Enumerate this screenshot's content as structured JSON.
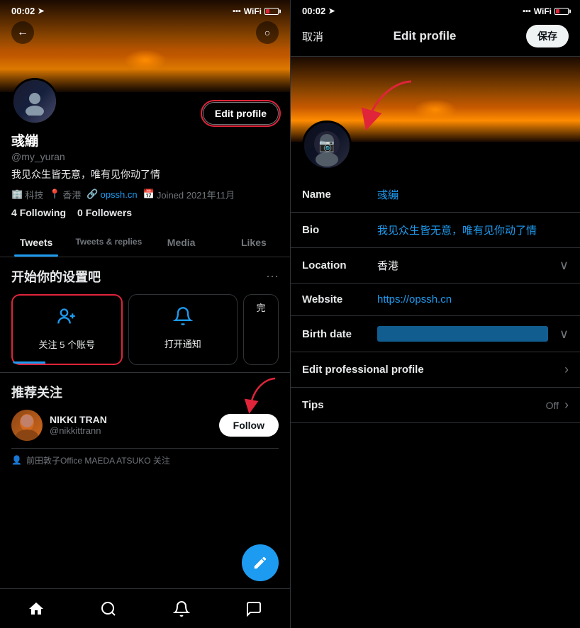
{
  "left": {
    "status_time": "00:02",
    "back_icon": "←",
    "search_icon": "🔍",
    "cover_alt": "sunset mountain cover",
    "avatar_emoji": "👩",
    "edit_profile_label": "Edit profile",
    "profile_name": "彧繃",
    "profile_handle": "@my_yuran",
    "profile_bio": "我见众生皆无意，唯有见你动了情",
    "meta_industry": "科技",
    "meta_location": "香港",
    "meta_website": "opssh.cn",
    "meta_joined": "Joined 2021年11月",
    "following_count": "4",
    "following_label": "Following",
    "followers_count": "0",
    "followers_label": "Followers",
    "tabs": [
      "Tweets",
      "Tweets & replies",
      "Media",
      "Likes"
    ],
    "active_tab": "Tweets",
    "setup_title": "开始你的设置吧",
    "setup_dots": "···",
    "setup_card1_text": "关注 5 个账号",
    "setup_card2_text": "打开通知",
    "setup_card3_text": "完",
    "recommended_title": "推荐关注",
    "rec_user_name": "NIKKI TRAN",
    "rec_user_handle": "@nikkittrann",
    "follow_label": "Follow",
    "mutual_text": "前田敦子Office MAEDA ATSUKO 关注",
    "fab_icon": "✎",
    "nav_home": "⌂",
    "nav_search": "🔍",
    "nav_bell": "🔔",
    "nav_mail": "✉"
  },
  "right": {
    "status_time": "00:02",
    "cancel_label": "取消",
    "title": "Edit profile",
    "save_label": "保存",
    "cover_alt": "sunset mountain cover",
    "avatar_overlay_icon": "📷",
    "name_label": "Name",
    "name_value": "彧繃",
    "bio_label": "Bio",
    "bio_value": "我见众生皆无意，唯有见你动了情",
    "location_label": "Location",
    "location_value": "香港",
    "website_label": "Website",
    "website_value": "https://opssh.cn",
    "birthdate_label": "Birth date",
    "birthdate_value": "",
    "edit_pro_label": "Edit professional profile",
    "tips_label": "Tips",
    "tips_value": "Off"
  }
}
